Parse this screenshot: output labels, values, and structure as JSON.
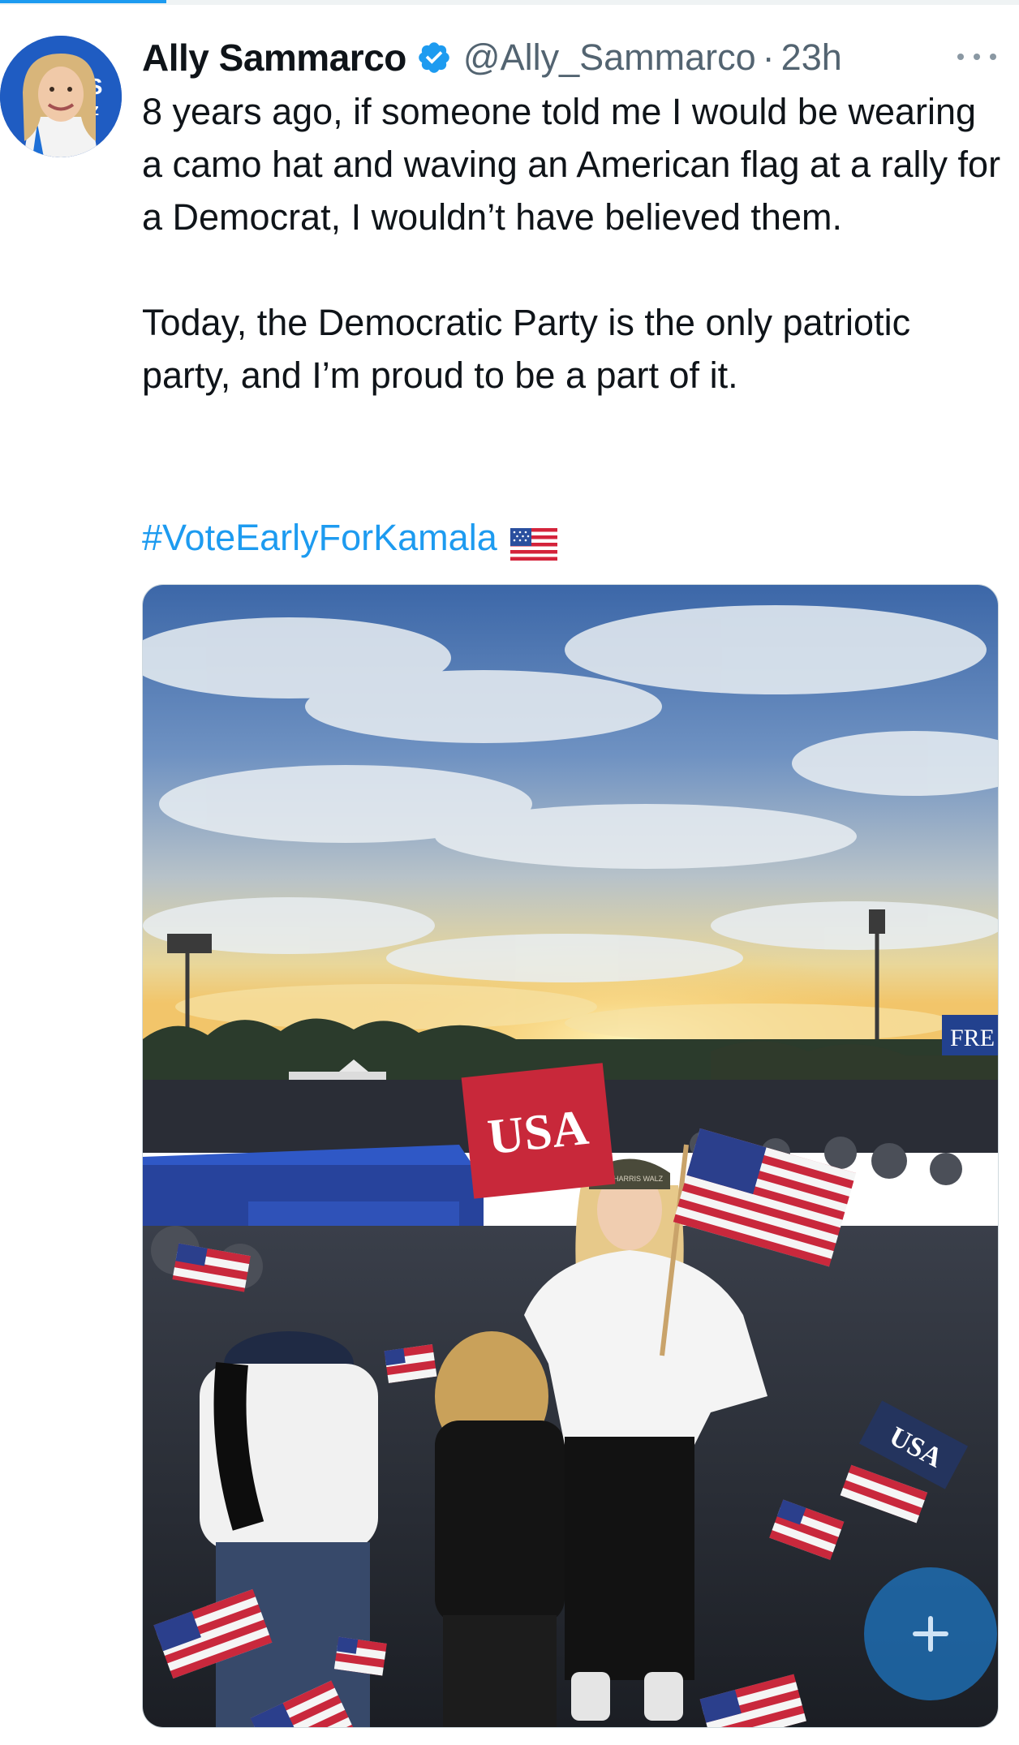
{
  "tweet": {
    "author_name": "Ally Sammarco",
    "handle": "@Ally_Sammarco",
    "separator": "·",
    "time": "23h",
    "text_para1": "8 years ago, if someone told me I would be wearing a camo hat and waving an American flag at a rally for a Democrat, I wouldn’t have believed them.",
    "text_para2": "Today, the Democratic Party is the only patriotic party, and I’m proud to be a part of it.",
    "hashtag": "#VoteEarlyForKamala",
    "flag_emoji": "us-flag-emoji"
  },
  "photo": {
    "sign_text": "USA",
    "hat_text": "HARRIS WALZ",
    "banner_text": "FRE",
    "ground_sign_text": "USA"
  },
  "icons": {
    "verified": "verified-badge-icon",
    "more": "more-options-icon",
    "compose": "plus-icon"
  },
  "colors": {
    "accent": "#1d9bf0",
    "text_primary": "#0f1419",
    "text_secondary": "#536471"
  }
}
